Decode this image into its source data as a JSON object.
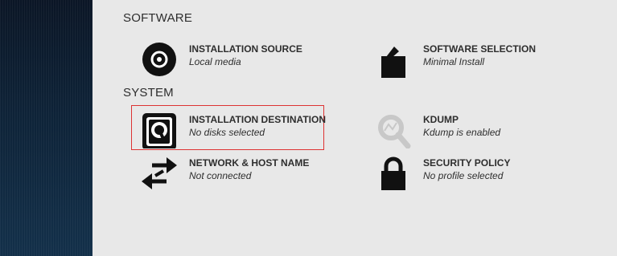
{
  "sections": {
    "software": {
      "heading": "SOFTWARE"
    },
    "system": {
      "heading": "SYSTEM"
    }
  },
  "spokes": {
    "installation_source": {
      "title": "INSTALLATION SOURCE",
      "status": "Local media",
      "icon": "disc-icon"
    },
    "software_selection": {
      "title": "SOFTWARE SELECTION",
      "status": "Minimal Install",
      "icon": "package-icon"
    },
    "installation_destination": {
      "title": "INSTALLATION DESTINATION",
      "status": "No disks selected",
      "icon": "hard-drive-icon",
      "selected": true,
      "highlight_color": "#dd3333"
    },
    "kdump": {
      "title": "KDUMP",
      "status": "Kdump is enabled",
      "icon": "magnifier-icon",
      "disabled": true
    },
    "network": {
      "title": "NETWORK & HOST NAME",
      "status": "Not connected",
      "icon": "network-arrows-icon"
    },
    "security_policy": {
      "title": "SECURITY POLICY",
      "status": "No profile selected",
      "icon": "padlock-icon"
    }
  }
}
